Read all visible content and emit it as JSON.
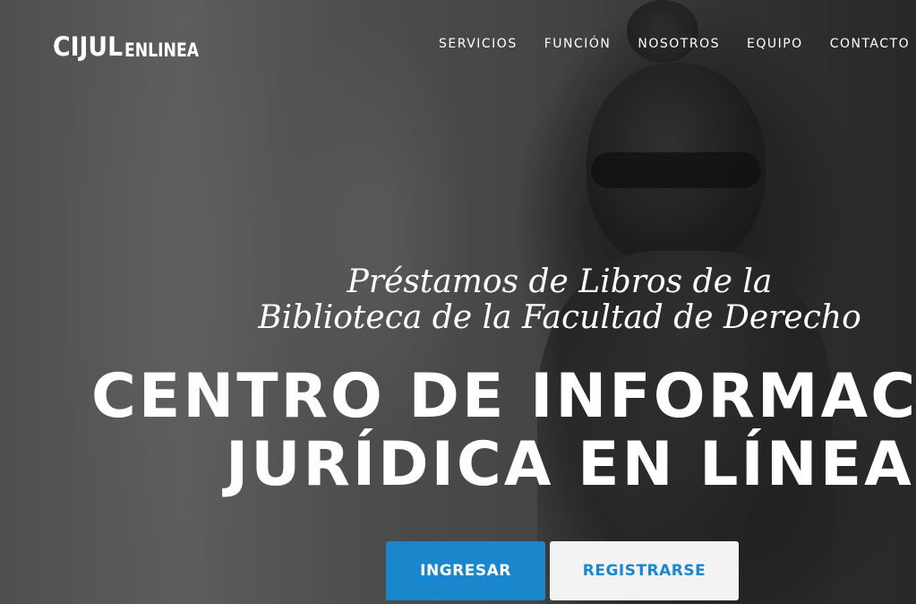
{
  "logo": {
    "strong": "CIJUL",
    "light": "ENLINEA"
  },
  "nav": {
    "items": [
      "SERVICIOS",
      "FUNCIÓN",
      "NOSOTROS",
      "EQUIPO",
      "CONTACTO"
    ]
  },
  "hero": {
    "subtitle_line1": "Préstamos de Libros de la",
    "subtitle_line2": "Biblioteca de la Facultad de Derecho",
    "title_line1": "CENTRO DE INFORMACIÓN",
    "title_line2": "JURÍDICA EN LÍNEA"
  },
  "buttons": {
    "primary_label": "INGRESAR",
    "secondary_label": "REGISTRARSE"
  },
  "colors": {
    "accent": "#1a86cc",
    "secondary_bg": "#f3f3f3",
    "text": "#ffffff"
  }
}
